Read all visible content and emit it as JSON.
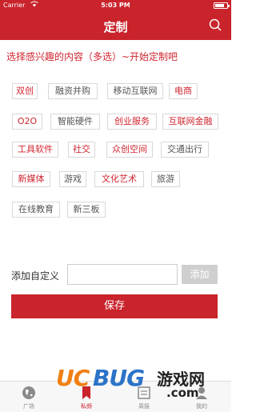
{
  "status_bar": {
    "carrier": "Carrier",
    "time": "5:03 PM",
    "battery_level": 0.8
  },
  "nav": {
    "title": "定制"
  },
  "prompt": "选择感兴趣的内容（多选）~开始定制吧",
  "tags": [
    {
      "label": "双创",
      "selected": true
    },
    {
      "label": "融资并购",
      "selected": false
    },
    {
      "label": "移动互联网",
      "selected": false
    },
    {
      "label": "电商",
      "selected": true
    },
    {
      "label": "O2O",
      "selected": true
    },
    {
      "label": "智能硬件",
      "selected": false
    },
    {
      "label": "创业服务",
      "selected": true
    },
    {
      "label": "互联网金融",
      "selected": true
    },
    {
      "label": "工具软件",
      "selected": true
    },
    {
      "label": "社交",
      "selected": true
    },
    {
      "label": "众创空间",
      "selected": true
    },
    {
      "label": "交通出行",
      "selected": false
    },
    {
      "label": "新媒体",
      "selected": true
    },
    {
      "label": "游戏",
      "selected": false
    },
    {
      "label": "文化艺术",
      "selected": true
    },
    {
      "label": "旅游",
      "selected": false
    },
    {
      "label": "在线教育",
      "selected": false
    },
    {
      "label": "新三板",
      "selected": false
    }
  ],
  "custom": {
    "label": "添加自定义",
    "input_value": "",
    "input_placeholder": "",
    "add_label": "添加"
  },
  "save_label": "保存",
  "tab_bar": {
    "tabs": [
      {
        "label": "广场",
        "icon": "globe-icon",
        "active": false
      },
      {
        "label": "私频",
        "icon": "bookmark-icon",
        "active": true
      },
      {
        "label": "周报",
        "icon": "newspaper-icon",
        "active": false
      },
      {
        "label": "我的",
        "icon": "person-icon",
        "active": false
      }
    ]
  },
  "watermark": {
    "uc": "UC",
    "bug": "BUG",
    "cn": "游戏网",
    "com": ".com"
  },
  "colors": {
    "brand_red": "#c9232b",
    "selected_text": "#d0252f",
    "disabled_button": "#cfcfcf",
    "watermark_orange": "#f07f12",
    "watermark_blue": "#2b73c8"
  }
}
